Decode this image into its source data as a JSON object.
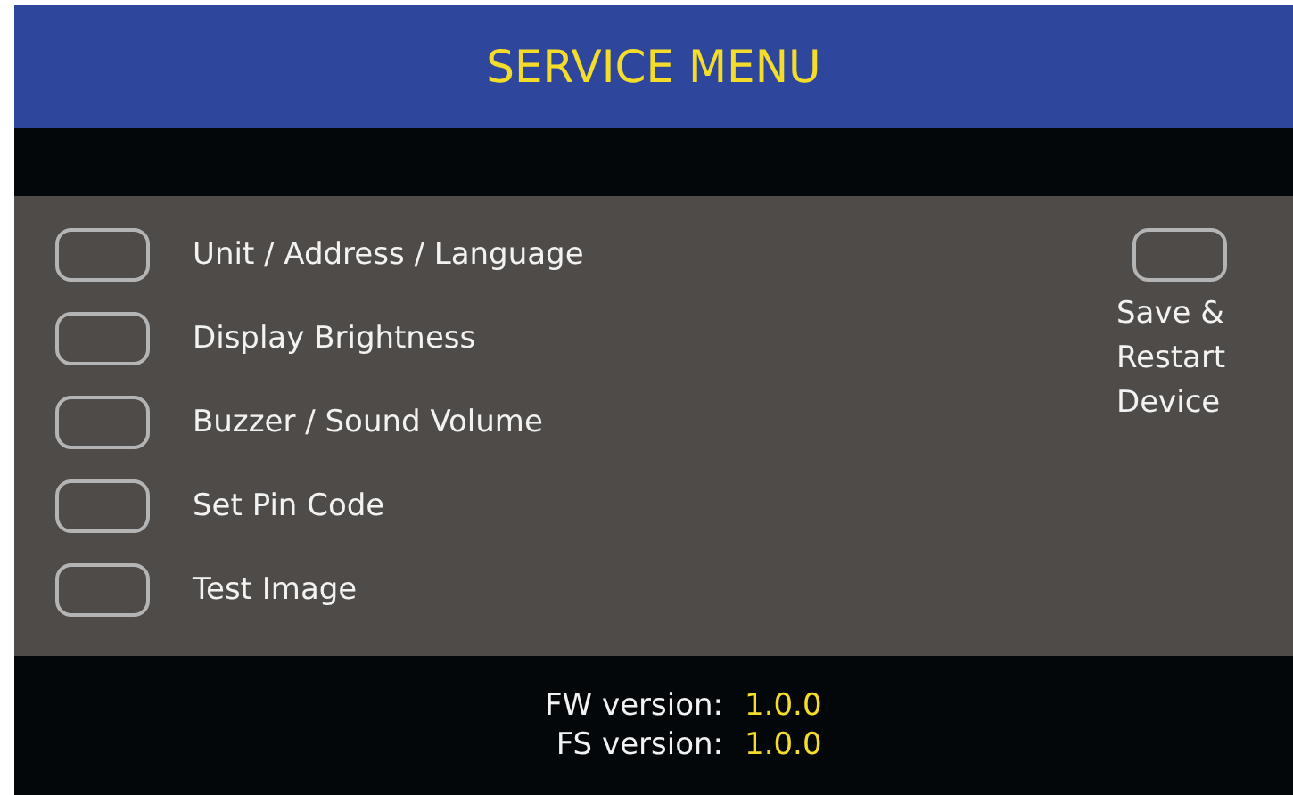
{
  "header": {
    "title": "SERVICE MENU"
  },
  "menu_items": [
    {
      "label": "Unit / Address / Language"
    },
    {
      "label": "Display Brightness"
    },
    {
      "label": "Buzzer / Sound Volume"
    },
    {
      "label": "Set Pin Code"
    },
    {
      "label": "Test Image"
    }
  ],
  "side_action": {
    "label": "Save & Restart Device"
  },
  "footer": [
    {
      "label": "FW version:",
      "value": "1.0.0"
    },
    {
      "label": "FS version:",
      "value": "1.0.0"
    }
  ]
}
